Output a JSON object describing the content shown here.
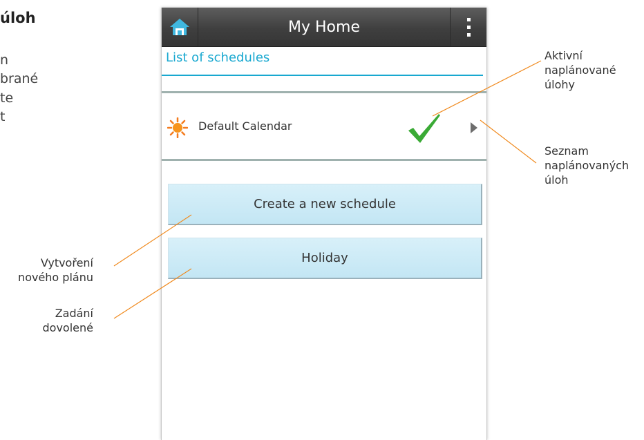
{
  "left_text": {
    "heading_fragment": "úloh",
    "fragment_1": "n",
    "fragment_2": "brané",
    "fragment_3": "te",
    "fragment_4": "t"
  },
  "app": {
    "title": "My Home",
    "section_header": "List of schedules",
    "schedules": [
      {
        "label": "Default Calendar",
        "active": true
      }
    ],
    "buttons": {
      "create_schedule": "Create a new schedule",
      "holiday": "Holiday"
    }
  },
  "callouts": {
    "active_schedules": [
      "Aktivní",
      "naplánované",
      "úlohy"
    ],
    "schedule_list": [
      "Seznam",
      "naplánovaných",
      "úloh"
    ],
    "create_plan": [
      "Vytvoření",
      "nového plánu"
    ],
    "holiday_entry": [
      "Zadání",
      "dovolené"
    ]
  },
  "colors": {
    "accent_blue": "#18a8d0",
    "leader_orange": "#f08a1e",
    "check_green": "#3aaa35",
    "button_bg": "#cdeaf6"
  },
  "icons": {
    "home": "home-icon",
    "menu": "overflow-menu-icon",
    "schedule": "sun-icon",
    "active": "checkmark-icon",
    "expand": "chevron-right-icon"
  }
}
